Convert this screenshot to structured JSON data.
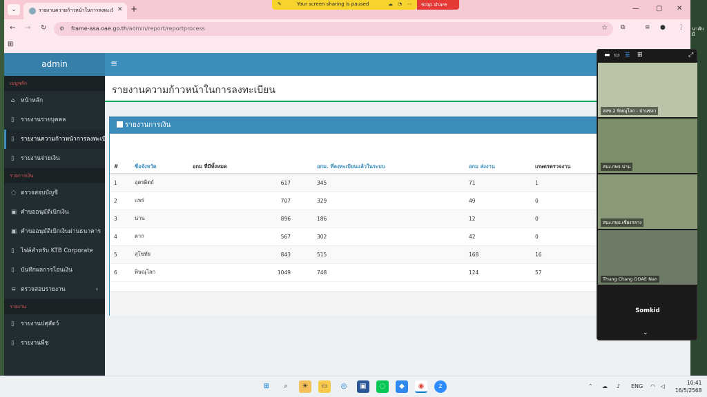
{
  "desktop": {
    "right_text": "นาคับ\nมี"
  },
  "browser": {
    "tab_title": "รายงานความก้าวหน้าในการลงทะเบีย",
    "share_banner": "Your screen sharing is paused",
    "stop_share": "Stop share",
    "url_host": "frame-asa.oae.go.th",
    "url_path": "/admin/report/reportprocess"
  },
  "app": {
    "logo": "admin",
    "sidebar": {
      "header_main": "เมนูหลัก",
      "main_items": [
        {
          "icon": "⌂",
          "label": "หน้าหลัก"
        },
        {
          "icon": "▯",
          "label": "รายงานรายบุคคล"
        },
        {
          "icon": "▯",
          "label": "รายงานความก้าวหน้าการลงทะเบีย"
        },
        {
          "icon": "▯",
          "label": "รายงานจ่ายเงิน"
        }
      ],
      "header_finance": "รายการเงิน",
      "finance_items": [
        {
          "icon": "◌",
          "label": "ตรวจสอบบัญชี"
        },
        {
          "icon": "▣",
          "label": "คำขออนุมัติเบิกเงิน"
        },
        {
          "icon": "▣",
          "label": "คำขออนุมัติเบิกเงินผ่านธนาคาร"
        },
        {
          "icon": "▯",
          "label": "ไฟล์สำหรับ KTB Corporate"
        },
        {
          "icon": "▯",
          "label": "บันทึกผลการโอนเงิน"
        },
        {
          "icon": "≡",
          "label": "ตรวจสอบรายงาน"
        }
      ],
      "header_report": "รายงาน",
      "report_items": [
        {
          "icon": "▯",
          "label": "รายงานปศุสัตว์"
        },
        {
          "icon": "▯",
          "label": "รายงานพืช"
        }
      ]
    },
    "page_title": "รายงานความก้าวหน้าในการลงทะเบียน",
    "box_title": "รายงานการเงิน",
    "table": {
      "headers": [
        "#",
        "ชื่อจังหวัด",
        "อกม ที่มีทั้งหมด",
        "อกม. ที่ลงทะเบียนแล้วในระบบ",
        "อกม ส่งงาน",
        "เกษตรตรวจงาน"
      ],
      "rows": [
        [
          "1",
          "อุตรดิตถ์",
          "617",
          "345",
          "71",
          "1"
        ],
        [
          "2",
          "แพร่",
          "707",
          "329",
          "49",
          "0"
        ],
        [
          "3",
          "น่าน",
          "896",
          "186",
          "12",
          "0"
        ],
        [
          "4",
          "ตาก",
          "567",
          "302",
          "42",
          "0"
        ],
        [
          "5",
          "สุโขทัย",
          "843",
          "515",
          "168",
          "16"
        ],
        [
          "6",
          "พิษณุโลก",
          "1049",
          "748",
          "124",
          "57"
        ]
      ]
    }
  },
  "zoom": {
    "participants": [
      {
        "name": "สสข.2 พิษณุโลก - ปานชลา",
        "bg": "#b9c4a8"
      },
      {
        "name": "สนง.กษจ.น่าน",
        "bg": "#7d8f6a"
      },
      {
        "name": "สนง.กษอ.เชียงกลาง",
        "bg": "#8a9a78"
      },
      {
        "name": "Thung Chang DOAE Nan",
        "bg": "#6e7b66"
      }
    ],
    "self_name": "Somkid"
  },
  "taskbar": {
    "lang": "ENG",
    "time": "10:41",
    "date": "16/5/2568"
  }
}
